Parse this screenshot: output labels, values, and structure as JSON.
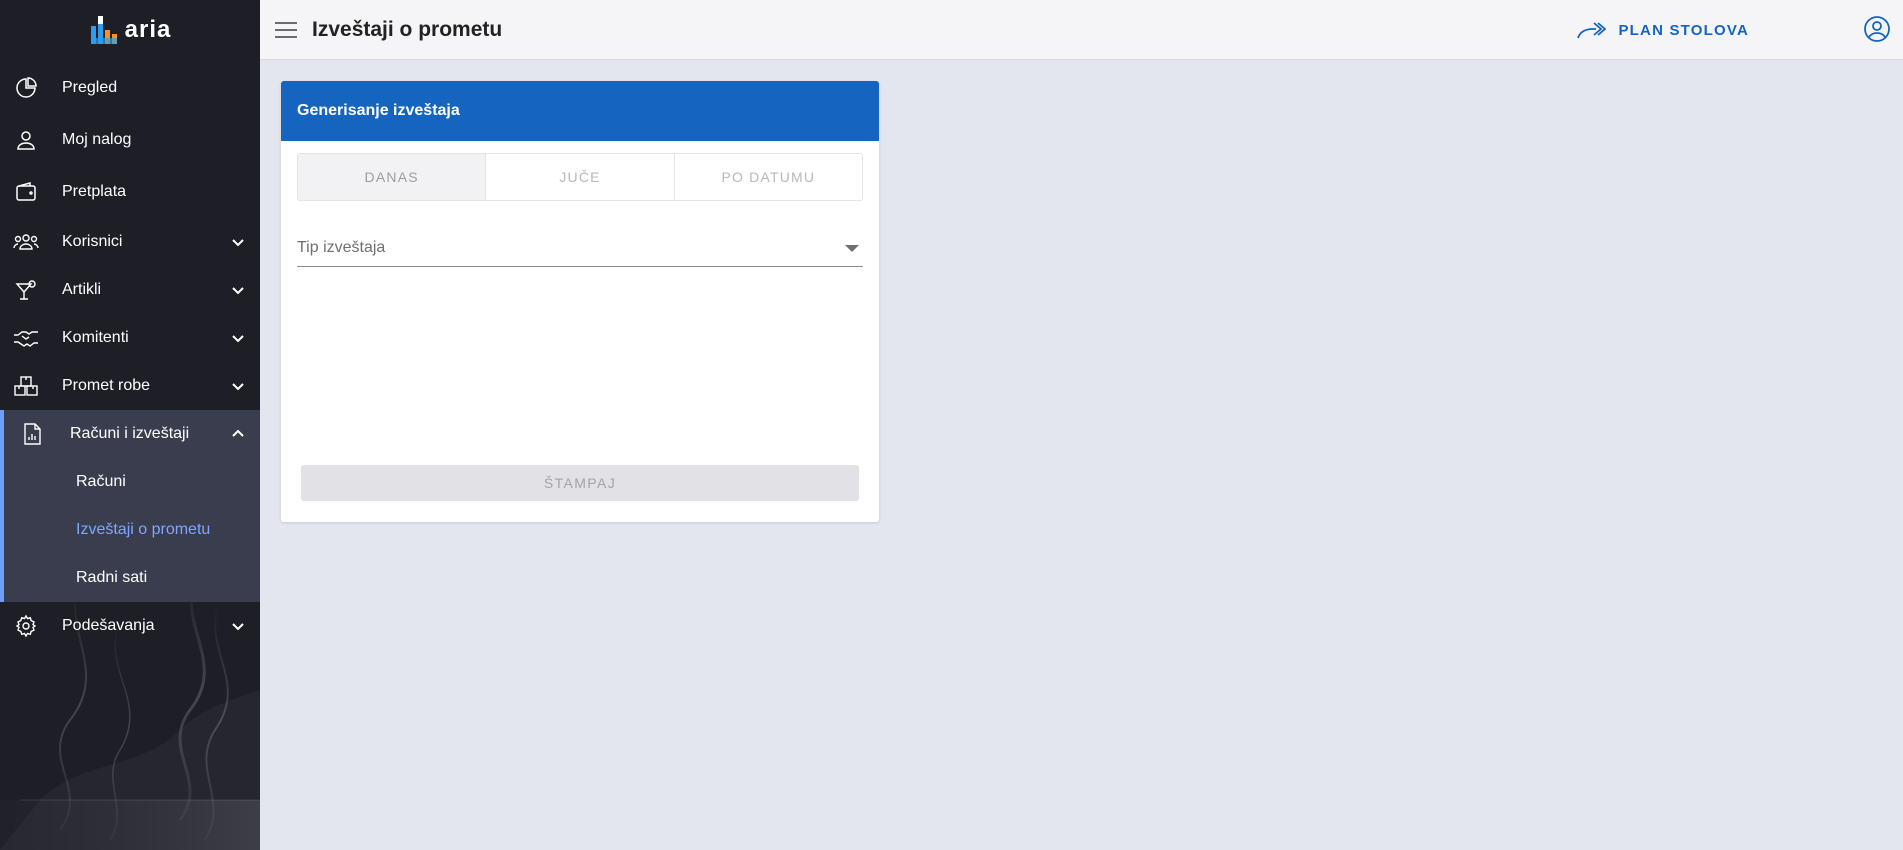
{
  "app": {
    "logo_text": "aria"
  },
  "header": {
    "title": "Izveštaji o prometu",
    "plan_button_label": "PLAN STOLOVA"
  },
  "sidebar": {
    "items": [
      {
        "label": "Pregled",
        "icon": "pie-chart-icon"
      },
      {
        "label": "Moj nalog",
        "icon": "person-icon"
      },
      {
        "label": "Pretplata",
        "icon": "wallet-icon"
      },
      {
        "label": "Korisnici",
        "icon": "users-icon"
      },
      {
        "label": "Artikli",
        "icon": "cocktail-icon"
      },
      {
        "label": "Komitenti",
        "icon": "handshake-icon"
      },
      {
        "label": "Promet robe",
        "icon": "boxes-icon"
      },
      {
        "label": "Računi i izveštaji",
        "icon": "report-document-icon"
      },
      {
        "label": "Podešavanja",
        "icon": "gear-icon"
      }
    ],
    "sub_items": [
      {
        "label": "Računi"
      },
      {
        "label": "Izveštaji o prometu"
      },
      {
        "label": "Radni sati"
      }
    ],
    "active_sub_item": "Izveštaji o prometu"
  },
  "report_card": {
    "title": "Generisanje izveštaja",
    "tabs": [
      {
        "label": "DANAS"
      },
      {
        "label": "JUČE"
      },
      {
        "label": "PO DATUMU"
      }
    ],
    "selected_tab": "DANAS",
    "report_type_placeholder": "Tip izveštaja",
    "print_button_label": "ŠTAMPAJ"
  },
  "colors": {
    "sidebar_bg": "#1d1e26",
    "accent": "#1565c0",
    "active_sub_item": "#7fa6ff",
    "content_bg": "#e4e6ef"
  }
}
